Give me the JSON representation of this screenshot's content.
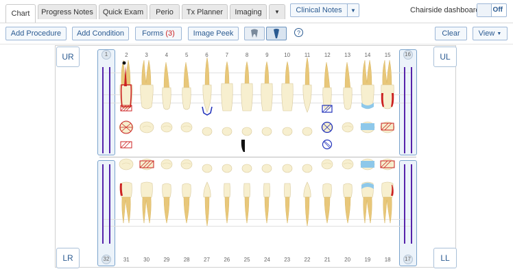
{
  "tabs": [
    {
      "label": "Chart",
      "active": true
    },
    {
      "label": "Progress Notes"
    },
    {
      "label": "Quick Exam"
    },
    {
      "label": "Perio"
    },
    {
      "label": "Tx Planner"
    },
    {
      "label": "Imaging"
    }
  ],
  "clinical_notes_label": "Clinical Notes",
  "chairside": {
    "label": "Chairside dashboard",
    "toggle_state": "Off"
  },
  "toolbar": {
    "add_procedure": "Add Procedure",
    "add_condition": "Add Condition",
    "forms_label": "Forms",
    "forms_count": "(3)",
    "image_peek": "Image Peek",
    "help": "?",
    "clear": "Clear",
    "view": "View"
  },
  "quadrants": {
    "ur": "UR",
    "ul": "UL",
    "lr": "LR",
    "ll": "LL"
  },
  "upper_teeth": [
    "1",
    "2",
    "3",
    "4",
    "5",
    "6",
    "7",
    "8",
    "9",
    "10",
    "11",
    "12",
    "13",
    "14",
    "15",
    "16"
  ],
  "lower_teeth": [
    "32",
    "31",
    "30",
    "29",
    "28",
    "27",
    "26",
    "25",
    "24",
    "23",
    "22",
    "21",
    "20",
    "19",
    "18",
    "17"
  ],
  "selected_teeth": [
    "1",
    "16",
    "32",
    "17"
  ],
  "colors": {
    "accent": "#2a5a91",
    "condition_red": "#cc2222",
    "filling_blue": "#8ec8ea",
    "procedure_blue": "#2233bb",
    "selection_purple": "#5522aa"
  }
}
